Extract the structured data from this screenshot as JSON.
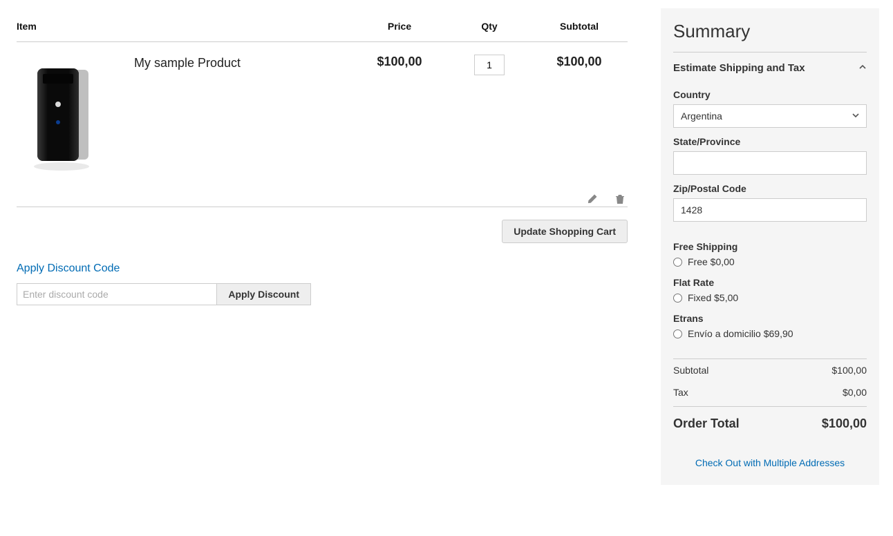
{
  "cart": {
    "headers": {
      "item": "Item",
      "price": "Price",
      "qty": "Qty",
      "subtotal": "Subtotal"
    },
    "items": [
      {
        "name": "My sample Product",
        "price": "$100,00",
        "qty": "1",
        "subtotal": "$100,00"
      }
    ],
    "update_button": "Update Shopping Cart"
  },
  "discount": {
    "toggle": "Apply Discount Code",
    "placeholder": "Enter discount code",
    "apply": "Apply Discount"
  },
  "summary": {
    "title": "Summary",
    "estimate_title": "Estimate Shipping and Tax",
    "country_label": "Country",
    "country_value": "Argentina",
    "state_label": "State/Province",
    "state_value": "",
    "zip_label": "Zip/Postal Code",
    "zip_value": "1428",
    "shipping": {
      "free_title": "Free Shipping",
      "free_option": "Free $0,00",
      "flat_title": "Flat Rate",
      "flat_option": "Fixed $5,00",
      "etrans_title": "Etrans",
      "etrans_option": "Envío a domicilio $69,90"
    },
    "totals": {
      "subtotal_label": "Subtotal",
      "subtotal_value": "$100,00",
      "tax_label": "Tax",
      "tax_value": "$0,00",
      "order_total_label": "Order Total",
      "order_total_value": "$100,00"
    },
    "multi_checkout": "Check Out with Multiple Addresses"
  }
}
